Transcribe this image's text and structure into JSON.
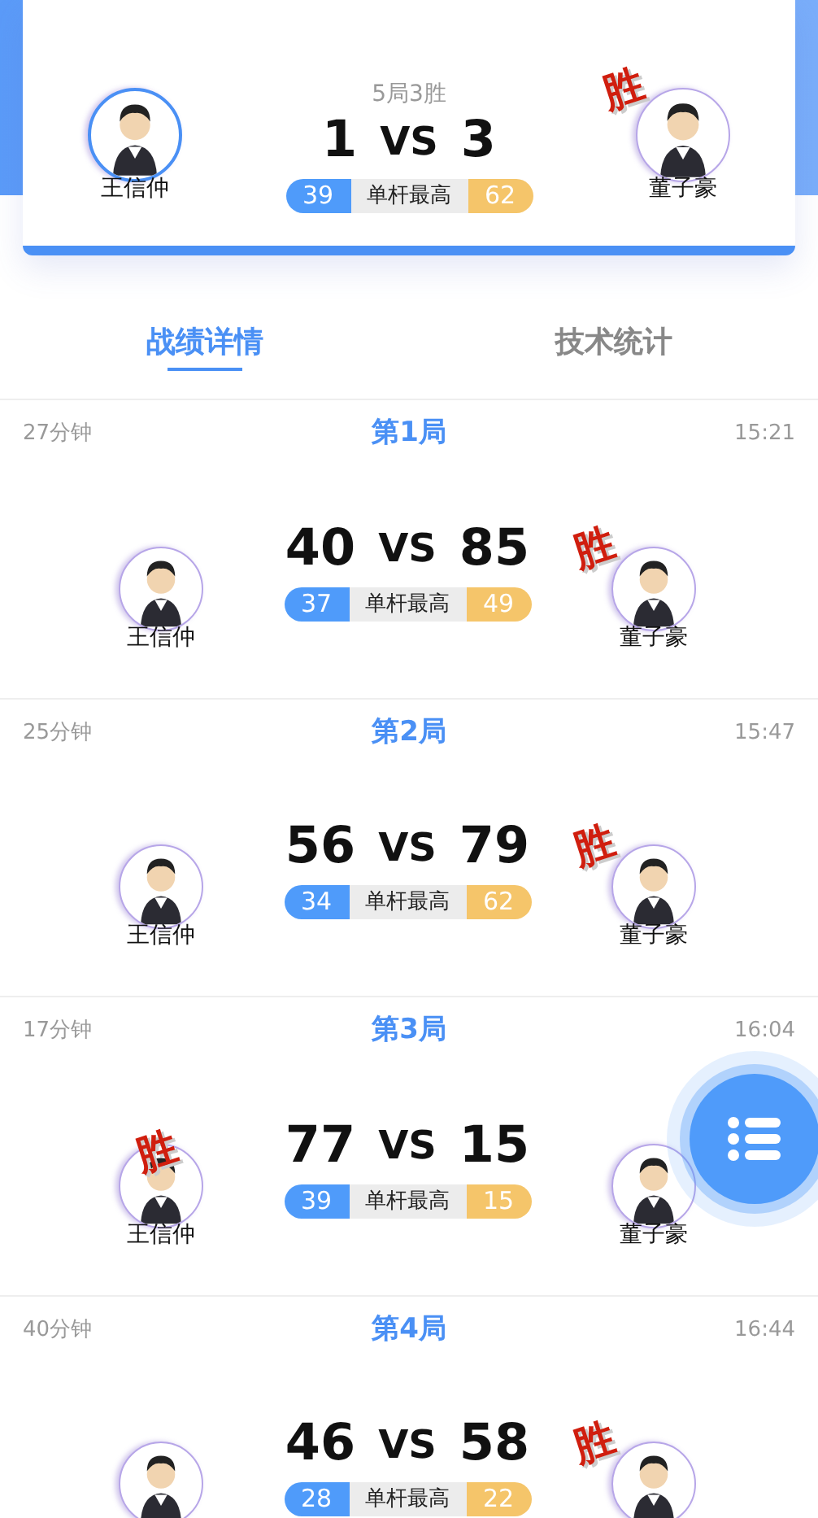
{
  "match": {
    "format": "5局3胜",
    "vs": "VS",
    "best_break_label": "单杆最高",
    "left": {
      "name": "王信仲",
      "score": "1",
      "best_break": "39"
    },
    "right": {
      "name": "董子豪",
      "score": "3",
      "best_break": "62",
      "stamp": "胜"
    }
  },
  "tabs": [
    {
      "label": "战绩详情",
      "selected": true
    },
    {
      "label": "技术统计",
      "selected": false
    }
  ],
  "games": [
    {
      "duration": "27分钟",
      "title": "第1局",
      "time": "15:21",
      "vs": "VS",
      "best_break_label": "单杆最高",
      "left": {
        "name": "王信仲",
        "score": "40",
        "best_break": "37"
      },
      "right": {
        "name": "董子豪",
        "score": "85",
        "best_break": "49",
        "stamp": "胜"
      }
    },
    {
      "duration": "25分钟",
      "title": "第2局",
      "time": "15:47",
      "vs": "VS",
      "best_break_label": "单杆最高",
      "left": {
        "name": "王信仲",
        "score": "56",
        "best_break": "34"
      },
      "right": {
        "name": "董子豪",
        "score": "79",
        "best_break": "62",
        "stamp": "胜"
      }
    },
    {
      "duration": "17分钟",
      "title": "第3局",
      "time": "16:04",
      "vs": "VS",
      "best_break_label": "单杆最高",
      "left": {
        "name": "王信仲",
        "score": "77",
        "best_break": "39",
        "stamp": "胜"
      },
      "right": {
        "name": "董子豪",
        "score": "15",
        "best_break": "15"
      }
    },
    {
      "duration": "40分钟",
      "title": "第4局",
      "time": "16:44",
      "vs": "VS",
      "best_break_label": "单杆最高",
      "left": {
        "score": "46",
        "best_break": "28"
      },
      "right": {
        "score": "58",
        "best_break": "22",
        "stamp": "胜"
      }
    }
  ]
}
